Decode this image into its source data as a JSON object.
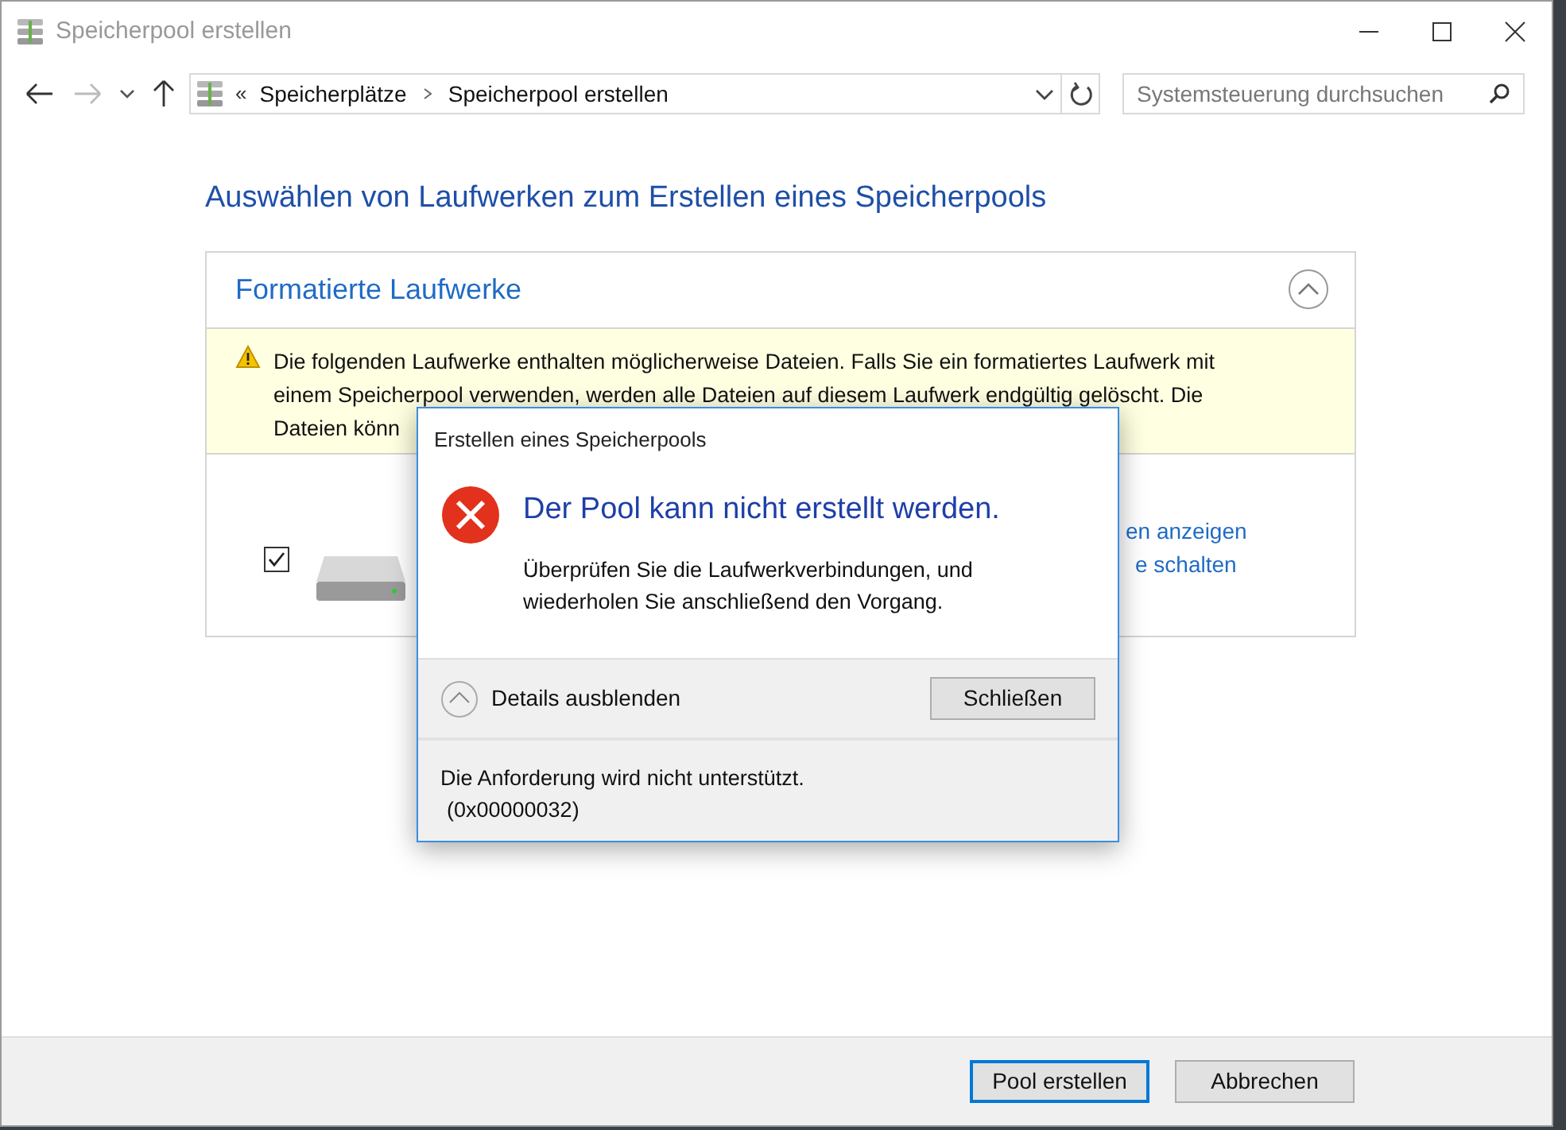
{
  "window": {
    "title": "Speicherpool erstellen"
  },
  "address_bar": {
    "overflow": "«",
    "breadcrumbs": [
      "Speicherplätze",
      "Speicherpool erstellen"
    ]
  },
  "search": {
    "placeholder": "Systemsteuerung durchsuchen"
  },
  "heading": "Auswählen von Laufwerken zum Erstellen eines Speicherpools",
  "section": {
    "title": "Formatierte Laufwerke",
    "expanded": true,
    "warning_lines": [
      "Die folgenden Laufwerke enthalten möglicherweise Dateien. Falls Sie ein formatiertes Laufwerk mit",
      "einem Speicherpool verwenden, werden alle Dateien auf diesem Laufwerk endgültig gelöscht. Die",
      "Dateien könn"
    ],
    "drive": {
      "checked": true,
      "links": [
        "en anzeigen",
        "e schalten"
      ]
    }
  },
  "dialog": {
    "title": "Erstellen eines Speicherpools",
    "message": "Der Pool kann nicht erstellt werden.",
    "detail": "Überprüfen Sie die Laufwerkverbindungen, und wiederholen Sie anschließend den Vorgang.",
    "details_toggle": "Details ausblenden",
    "details_expanded": true,
    "close_button": "Schließen",
    "error_lines": [
      "Die Anforderung wird nicht unterstützt.",
      "(0x00000032)"
    ]
  },
  "buttons": [
    {
      "label": "Pool erstellen",
      "default": true
    },
    {
      "label": "Abbrechen",
      "default": false
    }
  ]
}
